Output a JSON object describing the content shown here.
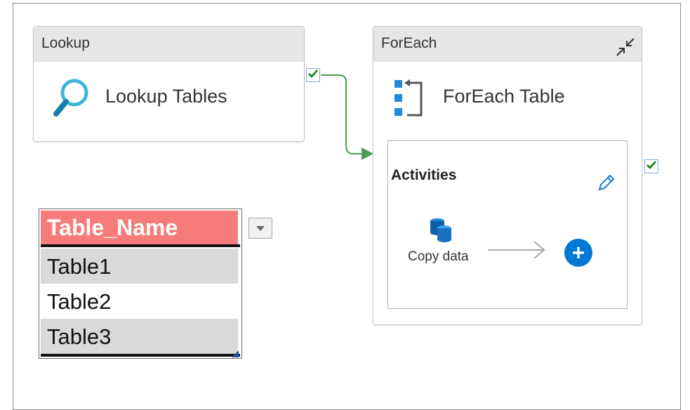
{
  "lookup": {
    "header": "Lookup",
    "title": "Lookup Tables"
  },
  "foreach": {
    "header": "ForEach",
    "title": "ForEach Table",
    "inner": {
      "title": "Activities",
      "activity_label": "Copy data"
    }
  },
  "sheet": {
    "header": "Table_Name",
    "rows": [
      "Table1",
      "Table2",
      "Table3"
    ]
  },
  "icons": {
    "lookup": "magnifier-icon",
    "foreach": "foreach-icon",
    "collapse": "collapse-icon",
    "edit": "pencil-icon",
    "copy": "copy-data-icon",
    "add": "plus-circle-icon",
    "success": "checkmark-icon",
    "dropdown": "dropdown-arrow-icon"
  },
  "colors": {
    "success_green": "#107c10",
    "connector_green": "#4f9a52",
    "accent_blue": "#0078d4",
    "lookup_icon": "#3cb5d6",
    "header_gray": "#e6e6e6",
    "sheet_header": "#f77b7b"
  }
}
